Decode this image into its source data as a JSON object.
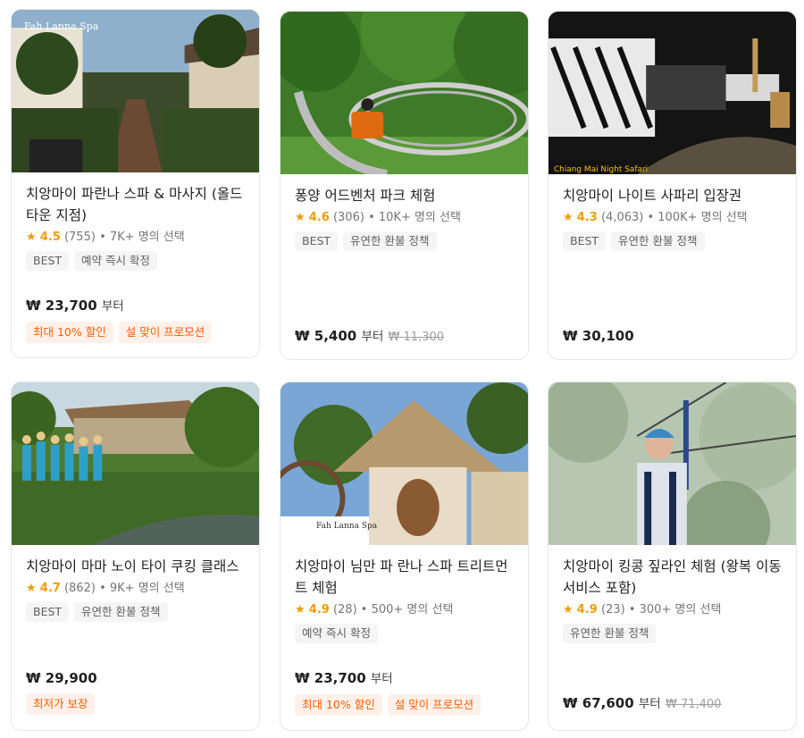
{
  "cards": [
    {
      "title": "치앙마이 파란나 스파 & 마사지 (올드 타운 지점)",
      "rating": "4.5",
      "reviews": "(755)",
      "popularity": "• 7K+ 명의 선택",
      "tags": [
        "BEST",
        "예약 즉시 확정"
      ],
      "price": "₩ 23,700",
      "price_suffix": "부터",
      "old_price": "",
      "promos": [
        "최대 10% 할인",
        "설 맞이 프로모션"
      ],
      "image": "spa-garden-walkway",
      "image_text": "Fah Lanna Spa"
    },
    {
      "title": "퐁양 어드벤처 파크 체험",
      "rating": "4.6",
      "reviews": "(306)",
      "popularity": "• 10K+ 명의 선택",
      "tags": [
        "BEST",
        "유연한 환불 정책"
      ],
      "price": "₩ 5,400",
      "price_suffix": "부터",
      "old_price": "₩ 11,300",
      "promos": [],
      "image": "jungle-coaster",
      "image_text": ""
    },
    {
      "title": "치앙마이 나이트 사파리 입장권",
      "rating": "4.3",
      "reviews": "(4,063)",
      "popularity": "• 100K+ 명의 선택",
      "tags": [
        "BEST",
        "유연한 환불 정책"
      ],
      "price": "₩ 30,100",
      "price_suffix": "",
      "old_price": "",
      "promos": [],
      "image": "night-safari-tram",
      "image_text": ""
    },
    {
      "title": "치앙마이 마마 노이 타이 쿠킹 클래스",
      "rating": "4.7",
      "reviews": "(862)",
      "popularity": "• 9K+ 명의 선택",
      "tags": [
        "BEST",
        "유연한 환불 정책"
      ],
      "price": "₩ 29,900",
      "price_suffix": "",
      "old_price": "",
      "promos": [
        "최저가 보장"
      ],
      "image": "cooking-class-garden",
      "image_text": ""
    },
    {
      "title": "치앙마이 님만 파 란나 스파 트리트먼트 체험",
      "rating": "4.9",
      "reviews": "(28)",
      "popularity": "• 500+ 명의 선택",
      "tags": [
        "예약 즉시 확정"
      ],
      "price": "₩ 23,700",
      "price_suffix": "부터",
      "old_price": "",
      "promos": [
        "최대 10% 할인",
        "설 맞이 프로모션"
      ],
      "image": "thatched-spa-pavilion",
      "image_text": "Fah Lanna Spa"
    },
    {
      "title": "치앙마이 킹콩 짚라인 체험 (왕복 이동 서비스 포함)",
      "rating": "4.9",
      "reviews": "(23)",
      "popularity": "• 300+ 명의 선택",
      "tags": [
        "유연한 환불 정책"
      ],
      "price": "₩ 67,600",
      "price_suffix": "부터",
      "old_price": "₩ 71,400",
      "promos": [],
      "image": "zipline-rider",
      "image_text": ""
    }
  ],
  "colors": {
    "rating_star": "#f09b0a",
    "promo_text": "#ff5b00",
    "promo_bg": "#fff1ea",
    "tag_bg": "#f5f5f5"
  }
}
